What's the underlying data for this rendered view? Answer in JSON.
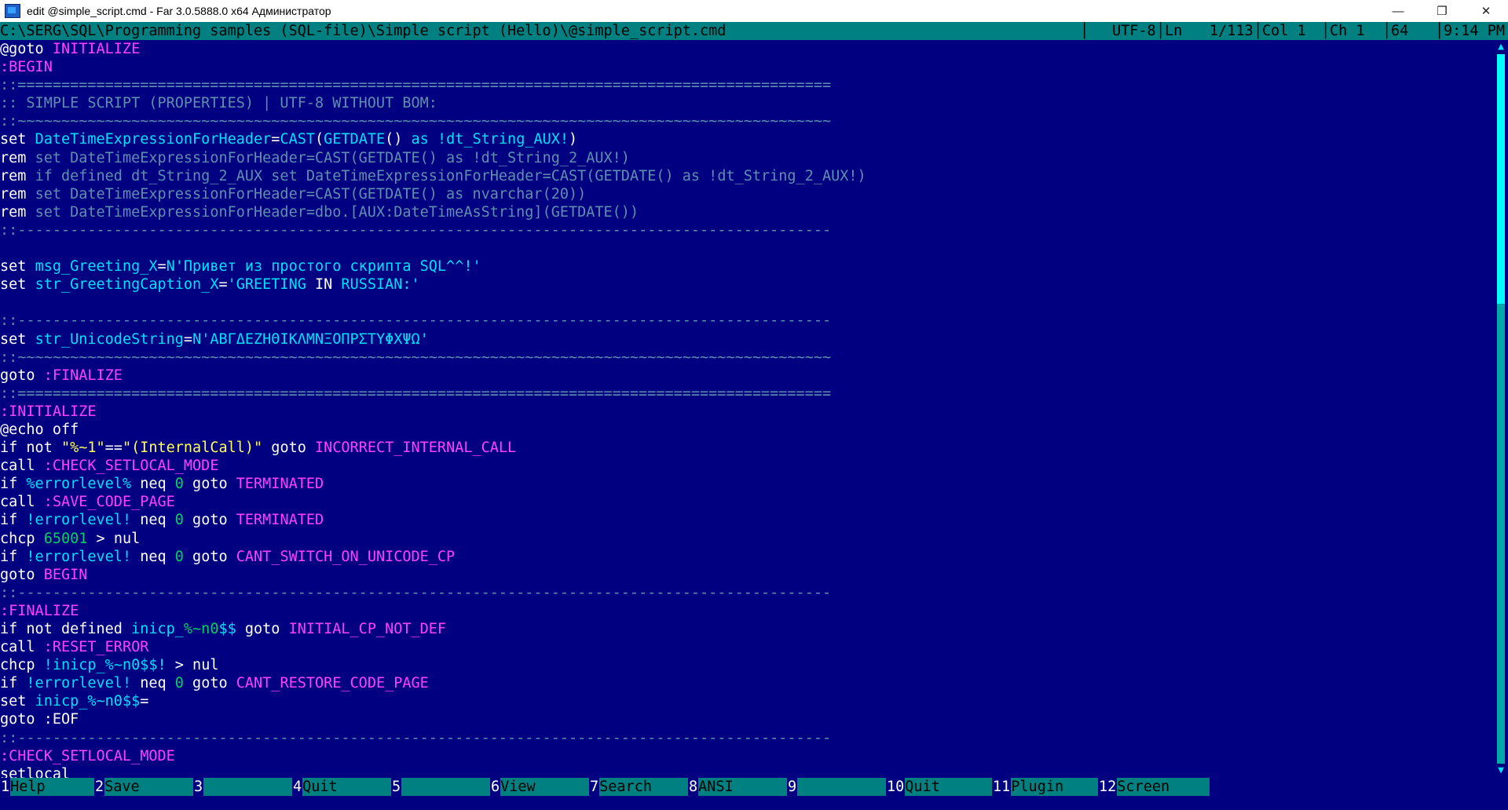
{
  "window": {
    "title": "edit @simple_script.cmd - Far 3.0.5888.0 x64 Администратор",
    "minimize": "—",
    "maximize": "❐",
    "close": "✕"
  },
  "status": {
    "path": "C:\\SERG\\SQL\\Programming samples (SQL-file)\\Simple script (Hello)\\@simple_script.cmd",
    "encoding": "UTF-8",
    "ln_label": "Ln",
    "ln_value": "1/113",
    "col": "Col 1",
    "ch": "Ch 1",
    "code": "64",
    "time": "9:14 PM"
  },
  "code_lines": [
    [
      [
        "w",
        "@goto "
      ],
      [
        "m",
        "INITIALIZE"
      ]
    ],
    [
      [
        "m",
        ":BEGIN"
      ]
    ],
    [
      [
        "g",
        "::============================================================================================="
      ]
    ],
    [
      [
        "g",
        ":: SIMPLE SCRIPT (PROPERTIES) | UTF-8 WITHOUT BOM:"
      ]
    ],
    [
      [
        "g",
        "::~~~~~~~~~~~~~~~~~~~~~~~~~~~~~~~~~~~~~~~~~~~~~~~~~~~~~~~~~~~~~~~~~~~~~~~~~~~~~~~~~~~~~~~~~~~~~"
      ]
    ],
    [
      [
        "w",
        "set "
      ],
      [
        "v",
        "DateTimeExpressionForHeader"
      ],
      [
        "w",
        "="
      ],
      [
        "v",
        "CAST"
      ],
      [
        "w",
        "("
      ],
      [
        "v",
        "GETDATE"
      ],
      [
        "w",
        "() "
      ],
      [
        "v",
        "as "
      ],
      [
        "v",
        "!dt_String_AUX!"
      ],
      [
        "w",
        ")"
      ]
    ],
    [
      [
        "w",
        "rem "
      ],
      [
        "g",
        "set DateTimeExpressionForHeader=CAST(GETDATE() as !dt_String_2_AUX!)"
      ]
    ],
    [
      [
        "w",
        "rem "
      ],
      [
        "g",
        "if defined dt_String_2_AUX set DateTimeExpressionForHeader=CAST(GETDATE() as !dt_String_2_AUX!)"
      ]
    ],
    [
      [
        "w",
        "rem "
      ],
      [
        "g",
        "set DateTimeExpressionForHeader=CAST(GETDATE() as nvarchar(20))"
      ]
    ],
    [
      [
        "w",
        "rem "
      ],
      [
        "g",
        "set DateTimeExpressionForHeader=dbo.[AUX:DateTimeAsString](GETDATE())"
      ]
    ],
    [
      [
        "g",
        "::---------------------------------------------------------------------------------------------"
      ]
    ],
    [
      [
        "w",
        ""
      ]
    ],
    [
      [
        "w",
        "set "
      ],
      [
        "v",
        "msg_Greeting_X"
      ],
      [
        "w",
        "="
      ],
      [
        "v",
        "N'Привет из простого скрипта SQL^^!'"
      ]
    ],
    [
      [
        "w",
        "set "
      ],
      [
        "v",
        "str_GreetingCaption_X"
      ],
      [
        "w",
        "="
      ],
      [
        "v",
        "'GREETING "
      ],
      [
        "w",
        "IN "
      ],
      [
        "v",
        "RUSSIAN:'"
      ]
    ],
    [
      [
        "w",
        ""
      ]
    ],
    [
      [
        "g",
        "::---------------------------------------------------------------------------------------------"
      ]
    ],
    [
      [
        "w",
        "set "
      ],
      [
        "v",
        "str_UnicodeString"
      ],
      [
        "w",
        "="
      ],
      [
        "v",
        "N'ΑΒΓΔΕΖΗΘΙΚΛΜΝΞΟΠΡΣΤΥΦΧΨΩ'"
      ]
    ],
    [
      [
        "g",
        "::~~~~~~~~~~~~~~~~~~~~~~~~~~~~~~~~~~~~~~~~~~~~~~~~~~~~~~~~~~~~~~~~~~~~~~~~~~~~~~~~~~~~~~~~~~~~~"
      ]
    ],
    [
      [
        "w",
        "goto "
      ],
      [
        "m",
        ":FINALIZE"
      ]
    ],
    [
      [
        "g",
        "::============================================================================================="
      ]
    ],
    [
      [
        "m",
        ":INITIALIZE"
      ]
    ],
    [
      [
        "w",
        "@echo off"
      ]
    ],
    [
      [
        "w",
        "if not "
      ],
      [
        "y",
        "\"%~1\""
      ],
      [
        "w",
        "=="
      ],
      [
        "y",
        "\"(InternalCall)\""
      ],
      [
        "w",
        " goto "
      ],
      [
        "m",
        "INCORRECT_INTERNAL_CALL"
      ]
    ],
    [
      [
        "w",
        "call "
      ],
      [
        "m",
        ":CHECK_SETLOCAL_MODE"
      ]
    ],
    [
      [
        "w",
        "if "
      ],
      [
        "v",
        "%errorlevel%"
      ],
      [
        "w",
        " neq "
      ],
      [
        "n",
        "0"
      ],
      [
        "w",
        " goto "
      ],
      [
        "m",
        "TERMINATED"
      ]
    ],
    [
      [
        "w",
        "call "
      ],
      [
        "m",
        ":SAVE_CODE_PAGE"
      ]
    ],
    [
      [
        "w",
        "if "
      ],
      [
        "v",
        "!errorlevel!"
      ],
      [
        "w",
        " neq "
      ],
      [
        "n",
        "0"
      ],
      [
        "w",
        " goto "
      ],
      [
        "m",
        "TERMINATED"
      ]
    ],
    [
      [
        "w",
        "chcp "
      ],
      [
        "n",
        "65001"
      ],
      [
        "w",
        " > nul"
      ]
    ],
    [
      [
        "w",
        "if "
      ],
      [
        "v",
        "!errorlevel!"
      ],
      [
        "w",
        " neq "
      ],
      [
        "n",
        "0"
      ],
      [
        "w",
        " goto "
      ],
      [
        "m",
        "CANT_SWITCH_ON_UNICODE_CP"
      ]
    ],
    [
      [
        "w",
        "goto "
      ],
      [
        "m",
        "BEGIN"
      ]
    ],
    [
      [
        "g",
        "::---------------------------------------------------------------------------------------------"
      ]
    ],
    [
      [
        "m",
        ":FINALIZE"
      ]
    ],
    [
      [
        "w",
        "if not defined "
      ],
      [
        "v",
        "inicp_"
      ],
      [
        "n",
        "%~n0"
      ],
      [
        "v",
        "$$"
      ],
      [
        "w",
        " goto "
      ],
      [
        "m",
        "INITIAL_CP_NOT_DEF"
      ]
    ],
    [
      [
        "w",
        "call "
      ],
      [
        "m",
        ":RESET_ERROR"
      ]
    ],
    [
      [
        "w",
        "chcp "
      ],
      [
        "v",
        "!inicp_%~n0$$!"
      ],
      [
        "w",
        " > nul"
      ]
    ],
    [
      [
        "w",
        "if "
      ],
      [
        "v",
        "!errorlevel!"
      ],
      [
        "w",
        " neq "
      ],
      [
        "n",
        "0"
      ],
      [
        "w",
        " goto "
      ],
      [
        "m",
        "CANT_RESTORE_CODE_PAGE"
      ]
    ],
    [
      [
        "w",
        "set "
      ],
      [
        "v",
        "inicp_%~n0$$"
      ],
      [
        "w",
        "="
      ]
    ],
    [
      [
        "w",
        "goto :EOF"
      ]
    ],
    [
      [
        "g",
        "::---------------------------------------------------------------------------------------------"
      ]
    ],
    [
      [
        "m",
        ":CHECK_SETLOCAL_MODE"
      ]
    ],
    [
      [
        "w",
        "setlocal"
      ]
    ]
  ],
  "keybar": [
    {
      "num": "1",
      "label": "Help"
    },
    {
      "num": "2",
      "label": "Save"
    },
    {
      "num": "3",
      "label": ""
    },
    {
      "num": "4",
      "label": "Quit"
    },
    {
      "num": "5",
      "label": ""
    },
    {
      "num": "6",
      "label": "View"
    },
    {
      "num": "7",
      "label": "Search"
    },
    {
      "num": "8",
      "label": "ANSI"
    },
    {
      "num": "9",
      "label": ""
    },
    {
      "num": "10",
      "label": "Quit"
    },
    {
      "num": "11",
      "label": "Plugin"
    },
    {
      "num": "12",
      "label": "Screen"
    }
  ],
  "scrollbar": {
    "up": "▲",
    "down": "▼"
  },
  "colors": {
    "background": "#000080",
    "statusbar": "#008080",
    "keyword": "#ffffff",
    "variable": "#00e0ff",
    "label": "#ff40ff",
    "comment": "#5f8fb0",
    "string": "#ffff55",
    "number": "#00d060"
  }
}
